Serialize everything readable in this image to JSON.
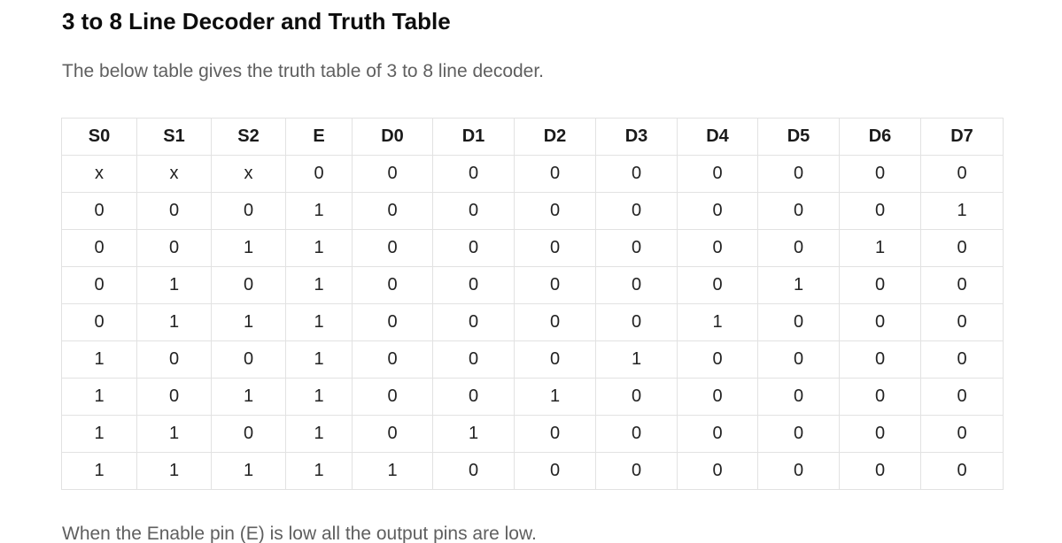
{
  "title": "3 to 8 Line Decoder and Truth Table",
  "intro": "The below table gives the truth table of 3 to 8 line decoder.",
  "table": {
    "headers": [
      "S0",
      "S1",
      "S2",
      "E",
      "D0",
      "D1",
      "D2",
      "D3",
      "D4",
      "D5",
      "D6",
      "D7"
    ],
    "rows": [
      [
        "x",
        "x",
        "x",
        "0",
        "0",
        "0",
        "0",
        "0",
        "0",
        "0",
        "0",
        "0"
      ],
      [
        "0",
        "0",
        "0",
        "1",
        "0",
        "0",
        "0",
        "0",
        "0",
        "0",
        "0",
        "1"
      ],
      [
        "0",
        "0",
        "1",
        "1",
        "0",
        "0",
        "0",
        "0",
        "0",
        "0",
        "1",
        "0"
      ],
      [
        "0",
        "1",
        "0",
        "1",
        "0",
        "0",
        "0",
        "0",
        "0",
        "1",
        "0",
        "0"
      ],
      [
        "0",
        "1",
        "1",
        "1",
        "0",
        "0",
        "0",
        "0",
        "1",
        "0",
        "0",
        "0"
      ],
      [
        "1",
        "0",
        "0",
        "1",
        "0",
        "0",
        "0",
        "1",
        "0",
        "0",
        "0",
        "0"
      ],
      [
        "1",
        "0",
        "1",
        "1",
        "0",
        "0",
        "1",
        "0",
        "0",
        "0",
        "0",
        "0"
      ],
      [
        "1",
        "1",
        "0",
        "1",
        "0",
        "1",
        "0",
        "0",
        "0",
        "0",
        "0",
        "0"
      ],
      [
        "1",
        "1",
        "1",
        "1",
        "1",
        "0",
        "0",
        "0",
        "0",
        "0",
        "0",
        "0"
      ]
    ]
  },
  "footer": "When the Enable pin (E) is low all the output pins are low.",
  "colors": {
    "title": "#0d0d0d",
    "body_text": "#5f5f5f",
    "table_border": "#e2e2e2"
  }
}
